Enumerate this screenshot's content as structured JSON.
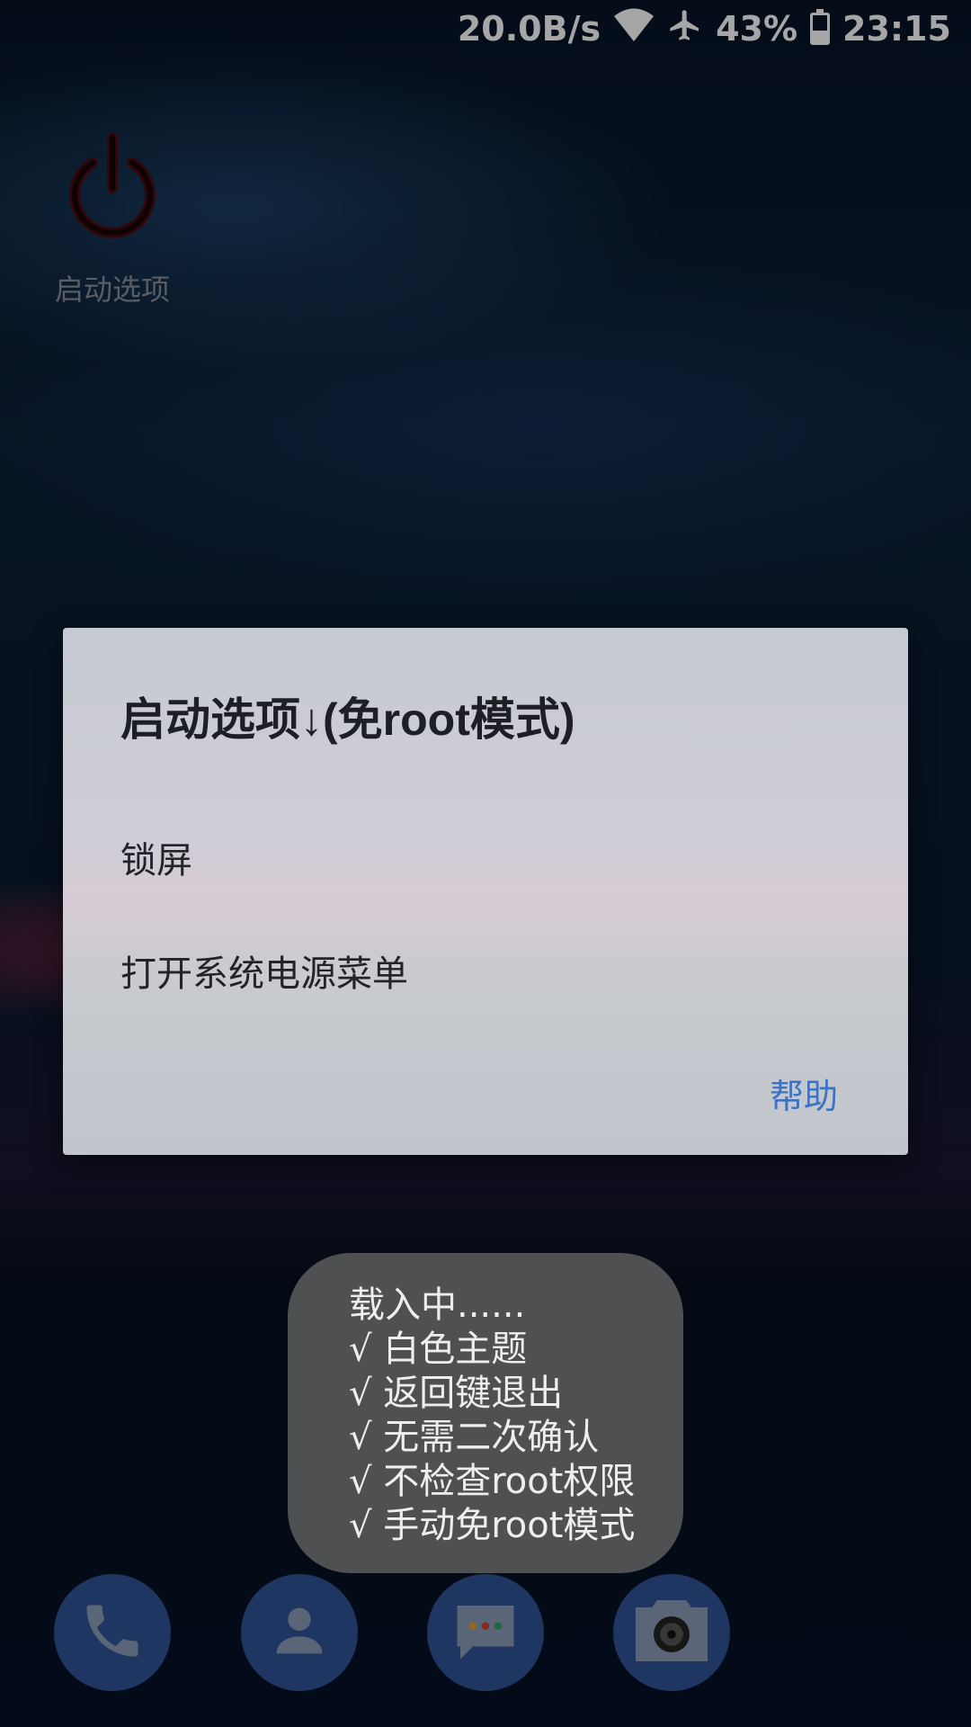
{
  "status_bar": {
    "net_speed": "20.0B/s",
    "battery_percent": "43%",
    "battery_level": 0.43,
    "time": "23:15",
    "icons": [
      "wifi-icon",
      "airplane-mode-icon",
      "battery-icon"
    ]
  },
  "home": {
    "shortcut_label": "启动选项",
    "shortcut_icon": "power-icon",
    "shortcut_icon_color": "#3a0a0e"
  },
  "dialog": {
    "title": "启动选项↓(免root模式)",
    "items": [
      "锁屏",
      "打开系统电源菜单"
    ],
    "help_label": "帮助",
    "accent_color": "#3e73c2"
  },
  "toast": {
    "lines": [
      "载入中......",
      "√ 白色主题",
      "√ 返回键退出",
      "√ 无需二次确认",
      "√ 不检查root权限",
      "√ 手动免root模式"
    ]
  },
  "dock": {
    "apps": [
      "phone-icon",
      "contacts-icon",
      "messages-icon",
      "camera-icon"
    ],
    "button_color": "#2f5395"
  }
}
